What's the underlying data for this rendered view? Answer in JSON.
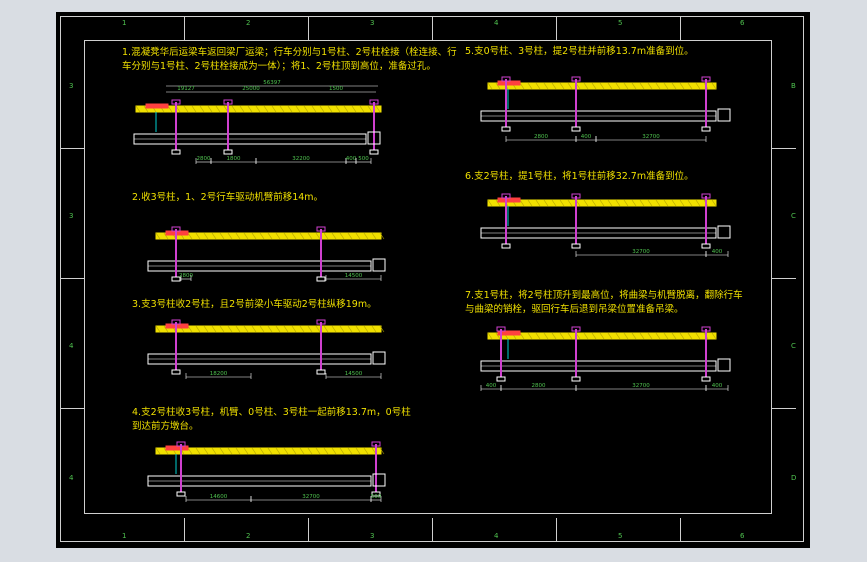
{
  "zones": {
    "top": [
      "1",
      "2",
      "3",
      "4",
      "5",
      "6"
    ],
    "bottom": [
      "1",
      "2",
      "3",
      "4",
      "5",
      "6"
    ],
    "left": [
      "3",
      "3",
      "4",
      "4"
    ],
    "right": [
      "B",
      "C",
      "C",
      "D"
    ]
  },
  "steps": [
    {
      "lines": [
        "1.混凝凳华后运梁车返回梁厂运梁；行车分别与1号柱、2号柱栓接（栓连接、行",
        "车分别与1号柱、2号柱栓接成为一体）；将1、2号柱顶到高位，准备过孔。"
      ],
      "dims": [
        "56397",
        "19127",
        "25000",
        "1500",
        "2800",
        "1800",
        "32200",
        "400",
        "500"
      ]
    },
    {
      "lines": [
        "2.收3号柱，1、2号行车驱动机臂前移14m。"
      ],
      "dims": [
        "2800",
        "14500"
      ]
    },
    {
      "lines": [
        "3.支3号柱收2号柱，且2号前梁小车驱动2号柱纵移19m。"
      ],
      "dims": [
        "18200",
        "14500"
      ]
    },
    {
      "lines": [
        "4.支2号柱收3号柱，机臂、0号柱、3号柱一起前移13.7m，0号柱",
        "到达前方墩台。"
      ],
      "dims": [
        "14600",
        "32700",
        "500"
      ]
    },
    {
      "lines": [
        "5.支0号柱、3号柱，提2号柱并前移13.7m准备到位。"
      ],
      "dims": [
        "2800",
        "400",
        "32700"
      ]
    },
    {
      "lines": [
        "6.支2号柱，提1号柱，将1号柱前移32.7m准备到位。"
      ],
      "dims": [
        "32700",
        "400"
      ]
    },
    {
      "lines": [
        "7.支1号柱，将2号柱顶升到最高位，将曲梁与机臂脱离，翻除行车",
        "与曲梁的销栓，驱回行车后退到吊梁位置准备吊梁。"
      ],
      "dims": [
        "400",
        "2800",
        "32700",
        "400"
      ]
    }
  ],
  "colors": {
    "background": "#000000",
    "frame": "#cfcfcf",
    "text": "#f0e000",
    "truss": "#f0e000",
    "girder": "#ffffff",
    "dimension": "#4fc24f",
    "leg": "#d040d0",
    "crane": "#ff4040",
    "cable": "#00d0d0"
  }
}
